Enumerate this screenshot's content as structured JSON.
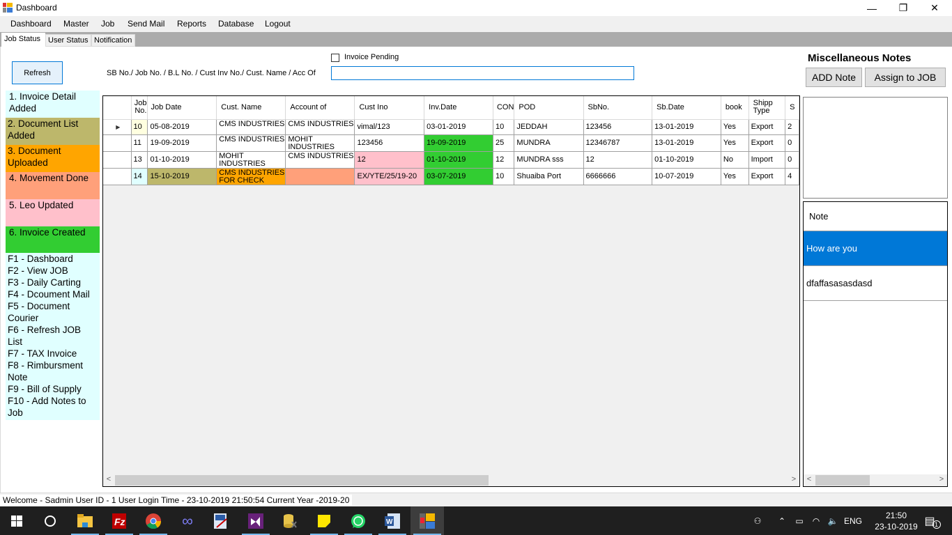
{
  "window": {
    "title": "Dashboard",
    "controls": {
      "minimize": "—",
      "restore": "❐",
      "close": "✕"
    }
  },
  "menu": [
    "Dashboard",
    "Master",
    "Job",
    "Send Mail",
    "Reports",
    "Database",
    "Logout"
  ],
  "tabs": [
    {
      "label": "Job Status",
      "active": true
    },
    {
      "label": "User Status",
      "active": false
    },
    {
      "label": "Notification",
      "active": false
    }
  ],
  "toolbar": {
    "refresh_label": "Refresh",
    "search_label": "SB No./ Job No. / B.L No. / Cust Inv No./ Cust. Name / Acc Of",
    "search_value": "",
    "invoice_pending_label": "Invoice Pending",
    "invoice_pending_checked": false
  },
  "legend": [
    {
      "label": "1. Invoice Detail Added",
      "color": "#e0ffff"
    },
    {
      "label": "2. Document List Added",
      "color": "#bdb76b"
    },
    {
      "label": "3. Document Uploaded",
      "color": "#ffa500"
    },
    {
      "label": "4. Movement Done",
      "color": "#ffa07a"
    },
    {
      "label": "5. Leo Updated",
      "color": "#ffc0cb"
    },
    {
      "label": "6. Invoice Created",
      "color": "#32cd32"
    }
  ],
  "shortcuts": [
    "F1 - Dashboard",
    "F2 - View JOB",
    "F3 - Daily Carting",
    "F4 - Dcoument Mail",
    "F5 - Document Courier",
    "F6 - Refresh JOB List",
    "F7 - TAX Invoice",
    "F8 - Rimbursment Note",
    "F9 - Bill of Supply",
    "F10 - Add Notes to Job"
  ],
  "grid": {
    "columns": [
      "Job No.",
      "Job Date",
      "Cust. Name",
      "Account of",
      "Cust Ino",
      "Inv.Date",
      "CON",
      "POD",
      "SbNo.",
      "Sb.Date",
      "book",
      "Shipp Type",
      "S"
    ],
    "rows": [
      {
        "selected": true,
        "cells": [
          "10",
          "05-08-2019",
          "CMS INDUSTRIES",
          "CMS INDUSTRIES",
          "vimal/123",
          "03-01-2019",
          "10",
          "JEDDAH",
          "123456",
          "13-01-2019",
          "Yes",
          "Export",
          "2"
        ],
        "colors": [
          "#ffffe0",
          "",
          "",
          "",
          "",
          "",
          "",
          "",
          "",
          "",
          "",
          "",
          ""
        ]
      },
      {
        "selected": false,
        "cells": [
          "11",
          "19-09-2019",
          "CMS INDUSTRIES",
          "MOHIT INDUSTRIES",
          "123456",
          "19-09-2019",
          "25",
          "MUNDRA",
          "12346787",
          "13-01-2019",
          "Yes",
          "Export",
          "0"
        ],
        "colors": [
          "",
          "",
          "",
          "",
          "",
          "#32cd32",
          "",
          "",
          "",
          "",
          "",
          "",
          ""
        ]
      },
      {
        "selected": false,
        "cells": [
          "13",
          "01-10-2019",
          "MOHIT INDUSTRIES",
          "CMS INDUSTRIES",
          "12",
          "01-10-2019",
          "12",
          "MUNDRA sss",
          "12",
          "01-10-2019",
          "No",
          "Import",
          "0"
        ],
        "colors": [
          "",
          "",
          "",
          "",
          "#ffc0cb",
          "#32cd32",
          "",
          "",
          "",
          "",
          "",
          "",
          ""
        ]
      },
      {
        "selected": false,
        "cells": [
          "14",
          "15-10-2019",
          "CMS INDUSTRIES FOR CHECK",
          "",
          "EX/YTE/25/19-20",
          "03-07-2019",
          "10",
          "Shuaiba Port",
          "6666666",
          "10-07-2019",
          "Yes",
          "Export",
          "4"
        ],
        "colors": [
          "#e0ffff",
          "#bdb76b",
          "#ffa500",
          "#ffa07a",
          "#ffc0cb",
          "#32cd32",
          "",
          "",
          "",
          "",
          "",
          "",
          ""
        ]
      }
    ],
    "scroll_position": 0
  },
  "notes": {
    "title": "Miscellaneous Notes",
    "add_label": "ADD Note",
    "assign_label": "Assign to JOB",
    "header": "Note",
    "items": [
      {
        "text": "How are you",
        "selected": true
      },
      {
        "text": "dfaffasasasdasd",
        "selected": false
      }
    ]
  },
  "status": {
    "text": "Welcome - Sadmin User ID - 1  User Login Time - 23-10-2019 21:50:54  Current Year -2019-20"
  },
  "taskbar": {
    "apps": [
      "start",
      "search",
      "file-explorer",
      "filezilla",
      "chrome",
      "infinity-app",
      "pen-tool",
      "visual-studio",
      "database-tool",
      "sticky-notes",
      "whatsapp",
      "word",
      "dashboard-app"
    ],
    "tray": {
      "language": "ENG",
      "time": "21:50",
      "date": "23-10-2019",
      "notifications": "1"
    }
  }
}
